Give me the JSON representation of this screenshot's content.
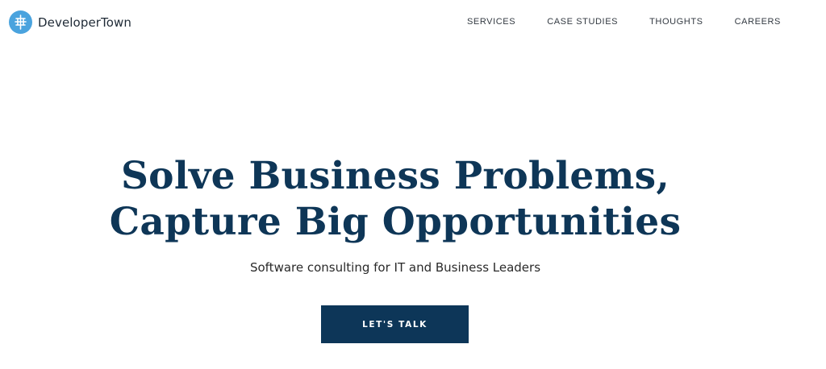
{
  "header": {
    "brand": {
      "name": "DeveloperTown",
      "logo_icon": "tree-icon",
      "logo_color": "#4aa3de"
    },
    "nav": [
      {
        "label": "SERVICES"
      },
      {
        "label": "CASE STUDIES"
      },
      {
        "label": "THOUGHTS"
      },
      {
        "label": "CAREERS"
      }
    ]
  },
  "hero": {
    "title_line1": "Solve Business Problems,",
    "title_line2": "Capture Big Opportunities",
    "subtitle": "Software consulting for IT and Business Leaders",
    "cta_label": "LET'S TALK",
    "title_color": "#0e3657",
    "cta_color": "#0d3658"
  }
}
